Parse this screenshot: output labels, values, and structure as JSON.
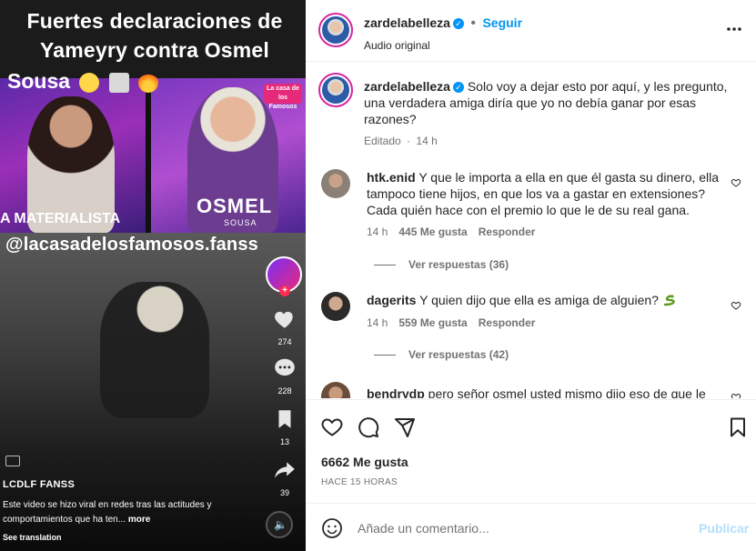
{
  "media": {
    "headline_line1": "Fuertes declaraciones de",
    "headline_line2": "Yameyry contra Osmel",
    "headline_line3": "Sousa",
    "label_left": "A MATERIALISTA",
    "label_right": "OSMEL",
    "label_right_sub": "SOUSA",
    "show_logo": "La casa de los Famosos",
    "handle_overlay": "@lacasadelosfamosos.fanss",
    "likes_count": "274",
    "comments_count": "228",
    "saves_count": "13",
    "shares_count": "39",
    "caption_user": "LCDLF FANSS",
    "caption_text": "Este video se hizo viral en redes tras las actitudes y comportamientos que ha ten...",
    "caption_more": "more",
    "see_translation": "See translation"
  },
  "header": {
    "username": "zardelabelleza",
    "follow_label": "Seguir",
    "audio_label": "Audio original",
    "more_icon": "more-horizontal-icon"
  },
  "post": {
    "username": "zardelabelleza",
    "caption": "Solo voy a dejar esto por aquí, y les pregunto, una verdadera amiga diría que yo no debía ganar por esas razones?",
    "edited_label": "Editado",
    "time": "14 h"
  },
  "comments": [
    {
      "username": "htk.enid",
      "text": "Y que le importa a ella en que él gasta su dinero, ella tampoco tiene hijos, en que los va a gastar en extensiones? Cada quién hace con el premio lo que le de su real gana.",
      "time": "14 h",
      "likes": "445 Me gusta",
      "reply": "Responder",
      "view_replies": "Ver respuestas (36)"
    },
    {
      "username": "dagerits",
      "text": "Y quien dijo que ella es amiga de alguien?",
      "time": "14 h",
      "likes": "559 Me gusta",
      "reply": "Responder",
      "view_replies": "Ver respuestas (42)"
    },
    {
      "username": "bendrydp",
      "text": "pero señor osmel usted mismo dijo eso de que le"
    }
  ],
  "actions": {
    "likes": "6662 Me gusta",
    "time_ago": "HACE 15 HORAS"
  },
  "composer": {
    "placeholder": "Añade un comentario...",
    "publish_label": "Publicar"
  },
  "colors": {
    "accent": "#0095f6",
    "muted": "#737373",
    "publish_disabled": "#b2dffc"
  }
}
